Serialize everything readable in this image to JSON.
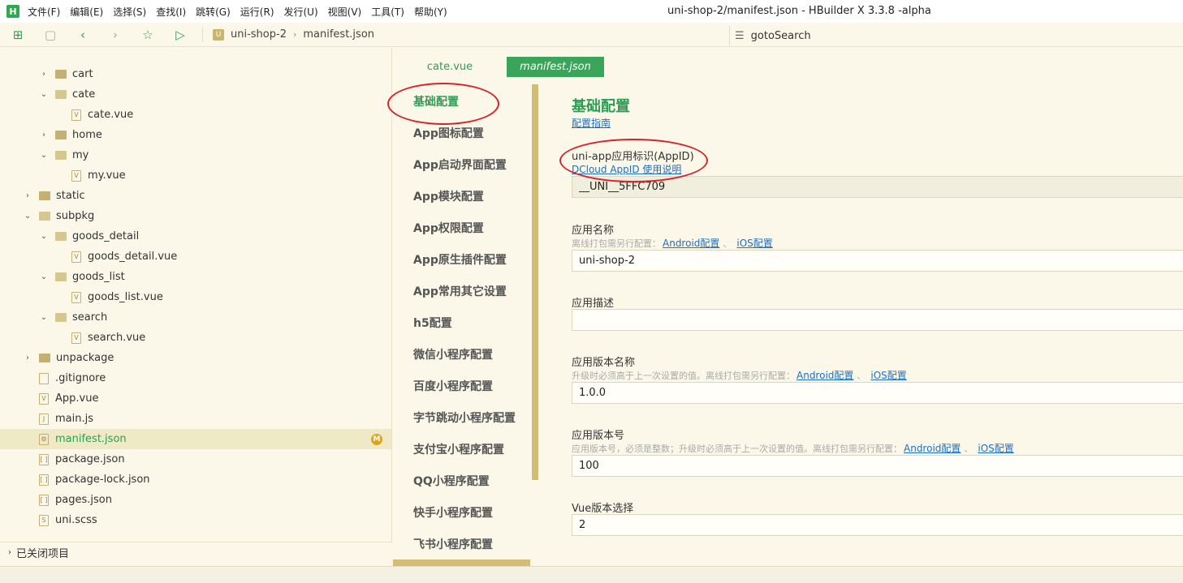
{
  "menubar": {
    "logo": "H",
    "items": [
      "文件(F)",
      "编辑(E)",
      "选择(S)",
      "查找(I)",
      "跳转(G)",
      "运行(R)",
      "发行(U)",
      "视图(V)",
      "工具(T)",
      "帮助(Y)"
    ],
    "title": "uni-shop-2/manifest.json - HBuilder X 3.3.8 -alpha"
  },
  "toolbar": {
    "breadcrumb": [
      "uni-shop-2",
      "manifest.json"
    ],
    "breadcrumb_icon": "U",
    "search_text": "gotoSearch"
  },
  "tree": {
    "rows": [
      {
        "label": "cart",
        "type": "folder",
        "indent": 2,
        "expanded": false
      },
      {
        "label": "cate",
        "type": "folder",
        "indent": 2,
        "expanded": true
      },
      {
        "label": "cate.vue",
        "type": "file-vue",
        "indent": 3
      },
      {
        "label": "home",
        "type": "folder",
        "indent": 2,
        "expanded": false
      },
      {
        "label": "my",
        "type": "folder",
        "indent": 2,
        "expanded": true
      },
      {
        "label": "my.vue",
        "type": "file-vue",
        "indent": 3
      },
      {
        "label": "static",
        "type": "folder",
        "indent": 1,
        "expanded": false
      },
      {
        "label": "subpkg",
        "type": "folder",
        "indent": 1,
        "expanded": true
      },
      {
        "label": "goods_detail",
        "type": "folder",
        "indent": 2,
        "expanded": true
      },
      {
        "label": "goods_detail.vue",
        "type": "file-vue",
        "indent": 3
      },
      {
        "label": "goods_list",
        "type": "folder",
        "indent": 2,
        "expanded": true
      },
      {
        "label": "goods_list.vue",
        "type": "file-vue",
        "indent": 3
      },
      {
        "label": "search",
        "type": "folder",
        "indent": 2,
        "expanded": true
      },
      {
        "label": "search.vue",
        "type": "file-vue",
        "indent": 3
      },
      {
        "label": "unpackage",
        "type": "folder",
        "indent": 1,
        "expanded": false
      },
      {
        "label": ".gitignore",
        "type": "file",
        "indent": 1
      },
      {
        "label": "App.vue",
        "type": "file-vue",
        "indent": 1
      },
      {
        "label": "main.js",
        "type": "file-js",
        "indent": 1
      },
      {
        "label": "manifest.json",
        "type": "file-json-cfg",
        "indent": 1,
        "selected": true,
        "badge": "M"
      },
      {
        "label": "package.json",
        "type": "file-json",
        "indent": 1
      },
      {
        "label": "package-lock.json",
        "type": "file-json",
        "indent": 1
      },
      {
        "label": "pages.json",
        "type": "file-json",
        "indent": 1
      },
      {
        "label": "uni.scss",
        "type": "file-scss",
        "indent": 1
      }
    ],
    "closed_projects": "已关闭项目"
  },
  "tabs": [
    {
      "label": "cate.vue",
      "active": false
    },
    {
      "label": "manifest.json",
      "active": true
    }
  ],
  "config_nav": [
    "基础配置",
    "App图标配置",
    "App启动界面配置",
    "App模块配置",
    "App权限配置",
    "App原生插件配置",
    "App常用其它设置",
    "h5配置",
    "微信小程序配置",
    "百度小程序配置",
    "字节跳动小程序配置",
    "支付宝小程序配置",
    "QQ小程序配置",
    "快手小程序配置",
    "飞书小程序配置"
  ],
  "form": {
    "title": "基础配置",
    "guide_link": "配置指南",
    "appid": {
      "label": "uni-app应用标识(AppID)",
      "link": "DCloud AppID 使用说明",
      "value": "__UNI__5FFC709"
    },
    "app_name": {
      "label": "应用名称",
      "hint": "离线打包需另行配置：",
      "link_android": "Android配置",
      "link_ios": "iOS配置",
      "value": "uni-shop-2"
    },
    "app_desc": {
      "label": "应用描述",
      "value": ""
    },
    "version_name": {
      "label": "应用版本名称",
      "hint": "升级时必须高于上一次设置的值。离线打包需另行配置：",
      "link_android": "Android配置",
      "link_ios": "iOS配置",
      "value": "1.0.0"
    },
    "version_code": {
      "label": "应用版本号",
      "hint": "应用版本号，必须是整数；升级时必须高于上一次设置的值。离线打包需另行配置：",
      "link_android": "Android配置",
      "link_ios": "iOS配置",
      "value": "100"
    },
    "vue_version": {
      "label": "Vue版本选择",
      "value": "2"
    }
  },
  "colors": {
    "accent": "#2e9d54",
    "annotation": "#d8242a",
    "background": "#fbf8ea",
    "link": "#1e6fbf"
  }
}
